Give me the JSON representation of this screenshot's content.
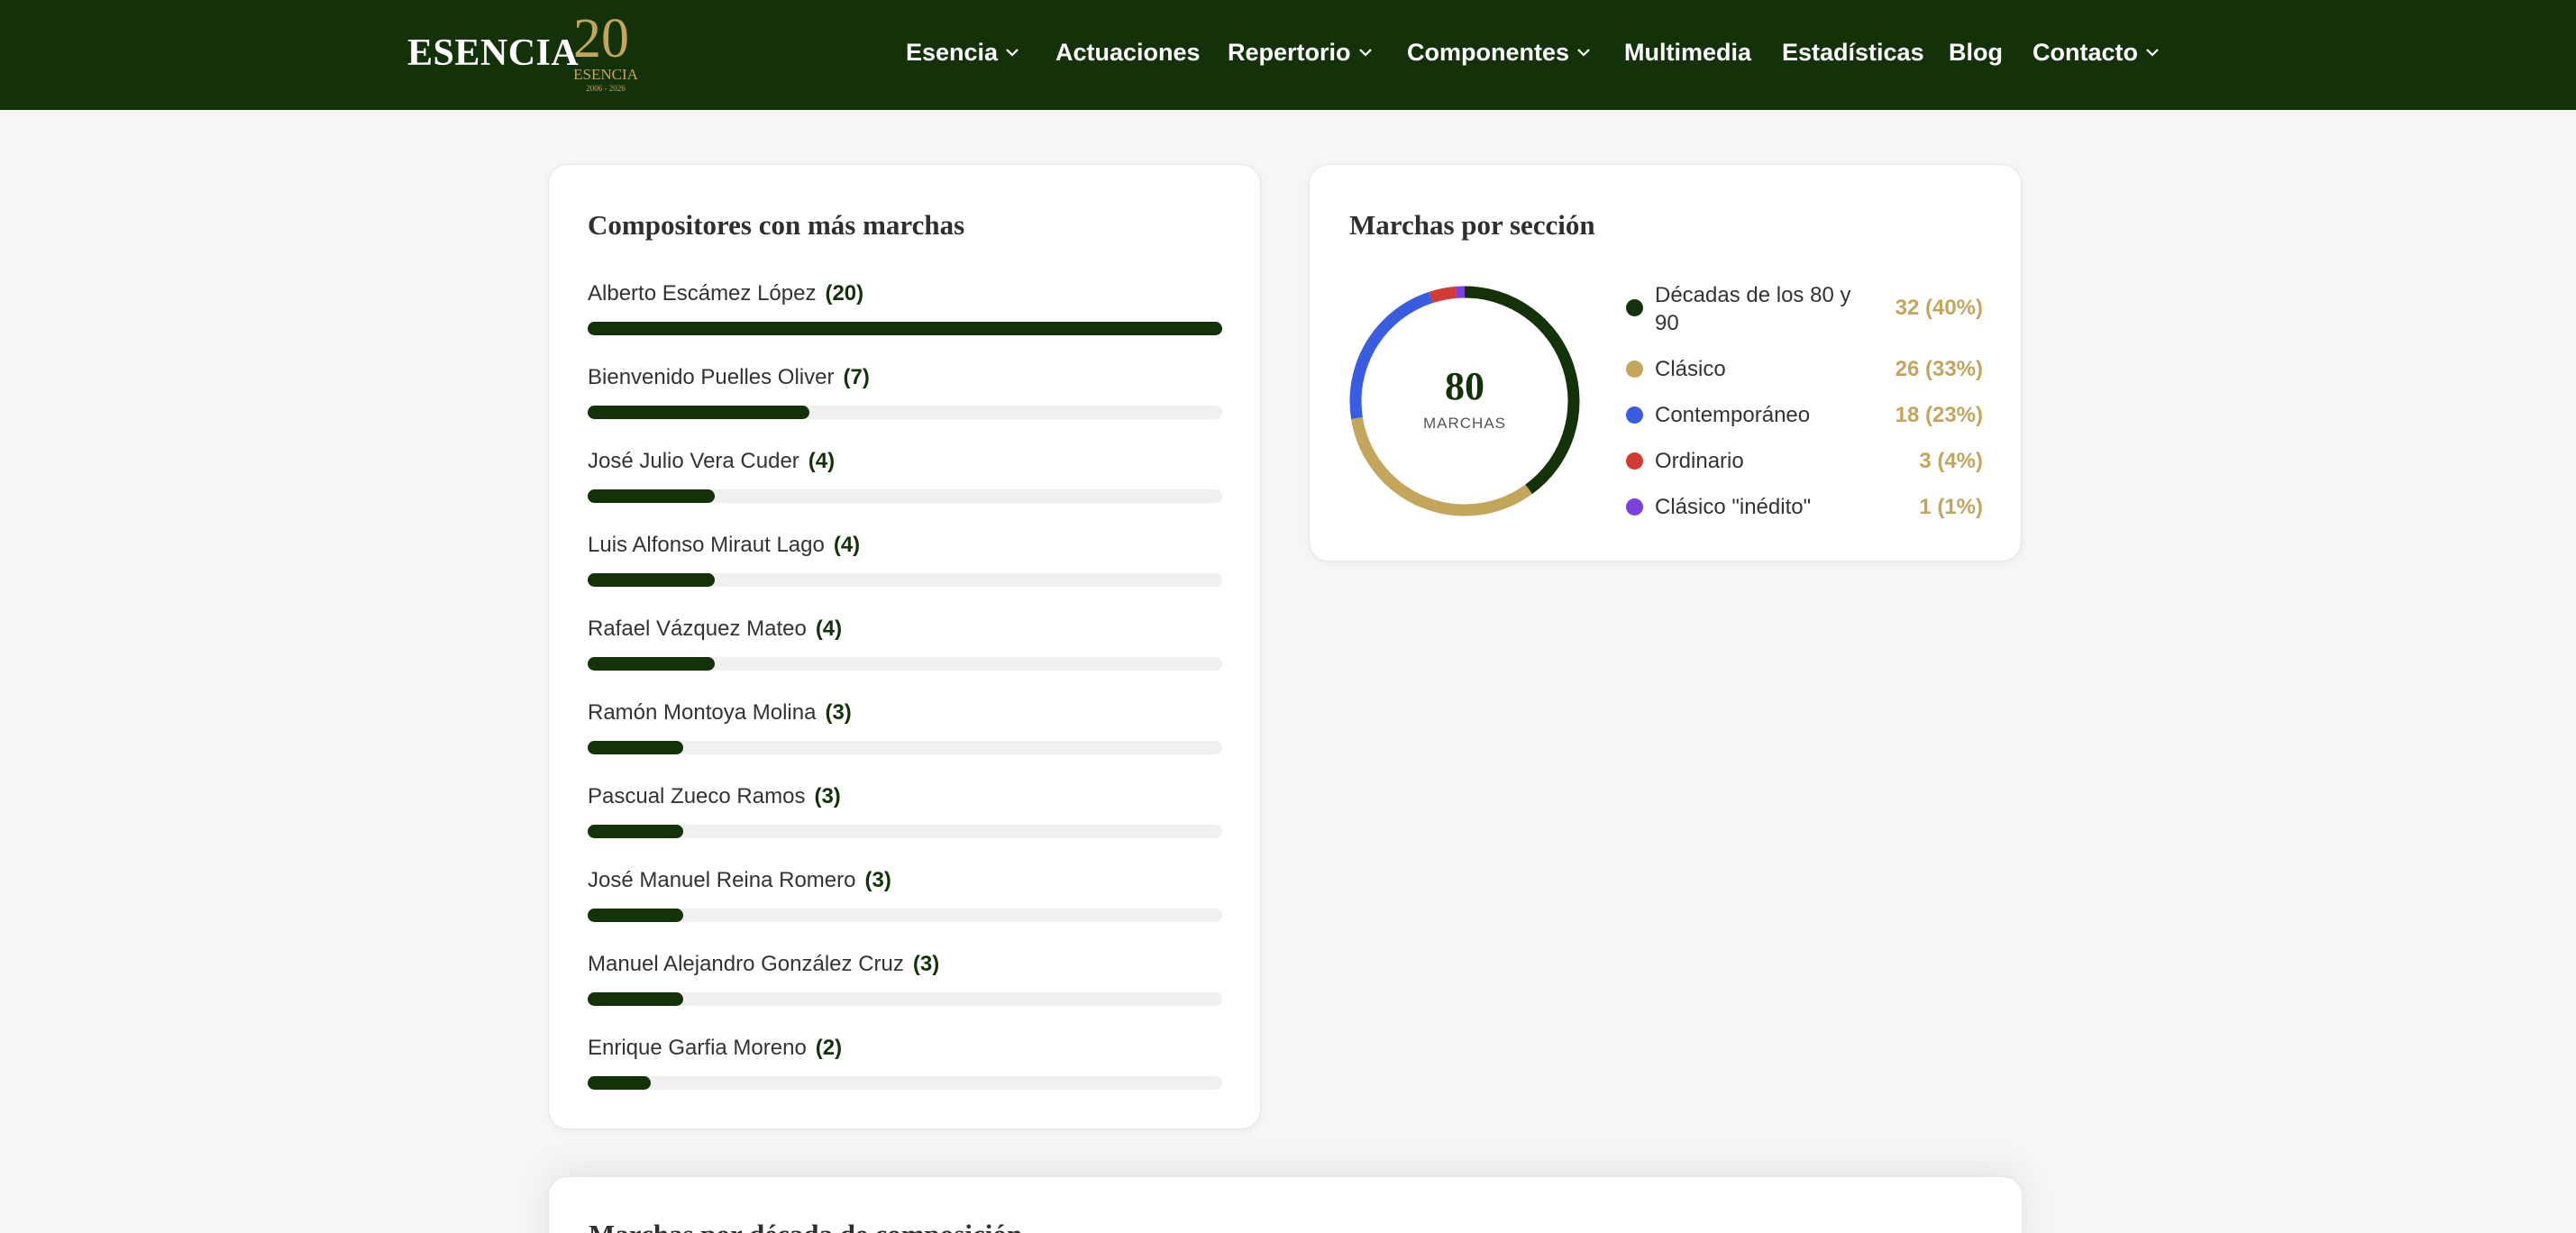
{
  "brand": {
    "name": "ESENCIA",
    "badge_number": "20",
    "badge_name": "ESENCIA",
    "badge_years": "2006 - 2026",
    "gold": "#c3a55c",
    "green": "#143209"
  },
  "nav": [
    {
      "label": "Esencia",
      "dropdown": true
    },
    {
      "label": "Actuaciones",
      "dropdown": false
    },
    {
      "label": "Repertorio",
      "dropdown": true
    },
    {
      "label": "Componentes",
      "dropdown": true
    },
    {
      "label": "Multimedia",
      "dropdown": false
    },
    {
      "label": "Estadísticas",
      "dropdown": false
    },
    {
      "label": "Blog",
      "dropdown": false
    },
    {
      "label": "Contacto",
      "dropdown": true
    }
  ],
  "composers": {
    "title": "Compositores con más marchas",
    "items": [
      {
        "name": "Alberto Escámez López",
        "count": "(20)",
        "value": 20
      },
      {
        "name": "Bienvenido Puelles Oliver",
        "count": "(7)",
        "value": 7
      },
      {
        "name": "José Julio Vera Cuder",
        "count": "(4)",
        "value": 4
      },
      {
        "name": "Luis Alfonso Miraut Lago",
        "count": "(4)",
        "value": 4
      },
      {
        "name": "Rafael Vázquez Mateo",
        "count": "(4)",
        "value": 4
      },
      {
        "name": "Ramón Montoya Molina",
        "count": "(3)",
        "value": 3
      },
      {
        "name": "Pascual Zueco Ramos",
        "count": "(3)",
        "value": 3
      },
      {
        "name": "José Manuel Reina Romero",
        "count": "(3)",
        "value": 3
      },
      {
        "name": "Manuel Alejandro González Cruz",
        "count": "(3)",
        "value": 3
      },
      {
        "name": "Enrique Garfia Moreno",
        "count": "(2)",
        "value": 2
      }
    ]
  },
  "sections": {
    "title": "Marchas por sección",
    "total": "80",
    "total_label": "MARCHAS",
    "items": [
      {
        "name": "Décadas de los 80 y 90",
        "value_label": "32 (40%)",
        "value": 32,
        "color": "#143209"
      },
      {
        "name": "Clásico",
        "value_label": "26 (33%)",
        "value": 26,
        "color": "#c3a55c"
      },
      {
        "name": "Contemporáneo",
        "value_label": "18 (23%)",
        "value": 18,
        "color": "#3a5ce0"
      },
      {
        "name": "Ordinario",
        "value_label": "3 (4%)",
        "value": 3,
        "color": "#d23a34"
      },
      {
        "name": "Clásico \"inédito\"",
        "value_label": "1 (1%)",
        "value": 1,
        "color": "#7c3fe0"
      }
    ]
  },
  "next_section": {
    "title": "Marchas por década de composición"
  }
}
